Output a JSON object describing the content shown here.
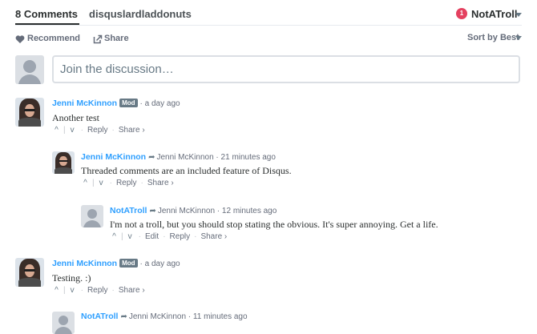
{
  "nav": {
    "comments_tab": "8 Comments",
    "forum_tab": "disquslardladdonuts",
    "notification_count": "1",
    "username": "NotATroll"
  },
  "actions": {
    "recommend": "Recommend",
    "share": "Share",
    "sort": "Sort by Best"
  },
  "composer": {
    "placeholder": "Join the discussion…"
  },
  "comments": [
    {
      "author": "Jenni McKinnon",
      "badge": "Mod",
      "time": "a day ago",
      "text": "Another test",
      "reply": "Reply",
      "share": "Share ›"
    },
    {
      "author": "Jenni McKinnon",
      "reply_to": "Jenni McKinnon",
      "time": "21 minutes ago",
      "text": "Threaded comments are an included feature of Disqus.",
      "reply": "Reply",
      "share": "Share ›"
    },
    {
      "author": "NotATroll",
      "reply_to": "Jenni McKinnon",
      "time": "12 minutes ago",
      "text": "I'm not a troll, but you should stop stating the obvious. It's super annoying. Get a life.",
      "edit": "Edit",
      "reply": "Reply",
      "share": "Share ›"
    },
    {
      "author": "Jenni McKinnon",
      "badge": "Mod",
      "time": "a day ago",
      "text": "Testing. :)",
      "reply": "Reply",
      "share": "Share ›"
    },
    {
      "author": "NotATroll",
      "reply_to": "Jenni McKinnon",
      "time": "11 minutes ago"
    }
  ],
  "glyphs": {
    "upvote": "^",
    "downvote": "v",
    "separator": "|",
    "dot": "·",
    "reply_arrow": "➦"
  },
  "colors": {
    "link": "#2e9fff",
    "notification": "#e4405f",
    "text": "#2a2e2e",
    "muted": "#656c7a"
  }
}
